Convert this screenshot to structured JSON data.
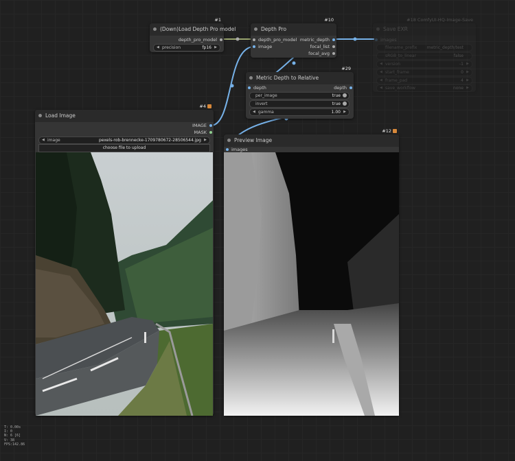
{
  "nodes": {
    "load_depth": {
      "id": "#1",
      "title": "(Down)Load Depth Pro model",
      "output": "depth_pro_model",
      "widget": {
        "label": "precision",
        "value": "fp16"
      }
    },
    "depth_pro": {
      "id": "#10",
      "title": "Depth Pro",
      "inputs": [
        "depth_pro_model",
        "image"
      ],
      "outputs": [
        "metric_depth",
        "focal_list",
        "focal_avg"
      ]
    },
    "save_exr": {
      "id": "#18 ComfyUI-HQ-Image-Save",
      "title": "Save EXR",
      "input": "images",
      "widgets": [
        {
          "label": "filename_prefix",
          "value": "metric_depth/test"
        },
        {
          "label": "sRGB_to_linear",
          "value": "false"
        },
        {
          "label": "version",
          "value": "-1"
        },
        {
          "label": "start_frame",
          "value": "0"
        },
        {
          "label": "frame_pad",
          "value": "4"
        },
        {
          "label": "save_workflow",
          "value": "none"
        }
      ]
    },
    "metric_rel": {
      "id": "#29",
      "title": "Metric Depth to Relative",
      "input": "depth",
      "output": "depth",
      "widgets": [
        {
          "label": "per_image",
          "value": "true"
        },
        {
          "label": "invert",
          "value": "true"
        },
        {
          "label": "gamma",
          "value": "1.00"
        }
      ]
    },
    "load_image": {
      "id": "#4",
      "title": "Load Image",
      "outputs": [
        "IMAGE",
        "MASK"
      ],
      "widget": {
        "label": "image",
        "value": "pexels-rob-brennecke-1709780672-28506544.jpg"
      },
      "upload_label": "choose file to upload"
    },
    "preview": {
      "id": "#12",
      "title": "Preview Image",
      "input": "images"
    }
  },
  "stats": [
    "T: 0.00s",
    "I: 0",
    "N: 6 [6]",
    "V: 38",
    "FPS:142.86"
  ],
  "colors": {
    "link": "#76b1e8",
    "canvas": "#202020",
    "node": "#353535",
    "badge": "#d7883a"
  }
}
